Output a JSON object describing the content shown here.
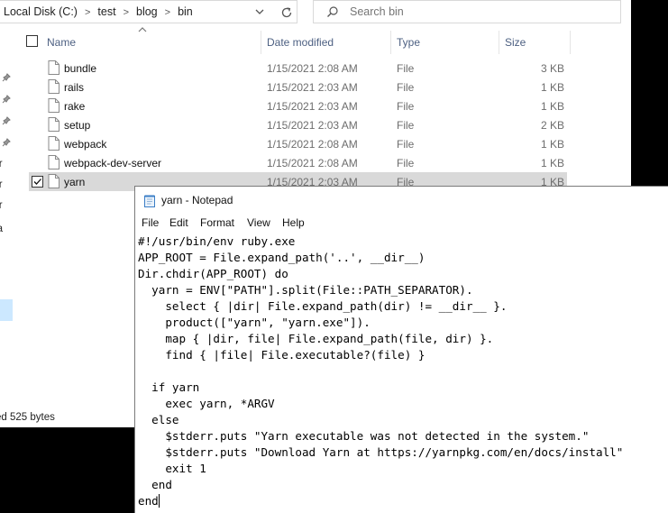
{
  "explorer": {
    "breadcrumb": [
      "Local Disk (C:)",
      "test",
      "blog",
      "bin"
    ],
    "search_placeholder": "Search bin",
    "columns": {
      "name": "Name",
      "date": "Date modified",
      "type": "Type",
      "size": "Size"
    },
    "files": [
      {
        "name": "bundle",
        "date": "1/15/2021 2:08 AM",
        "type": "File",
        "size": "3 KB"
      },
      {
        "name": "rails",
        "date": "1/15/2021 2:03 AM",
        "type": "File",
        "size": "1 KB"
      },
      {
        "name": "rake",
        "date": "1/15/2021 2:03 AM",
        "type": "File",
        "size": "1 KB"
      },
      {
        "name": "setup",
        "date": "1/15/2021 2:03 AM",
        "type": "File",
        "size": "2 KB"
      },
      {
        "name": "webpack",
        "date": "1/15/2021 2:08 AM",
        "type": "File",
        "size": "1 KB"
      },
      {
        "name": "webpack-dev-server",
        "date": "1/15/2021 2:08 AM",
        "type": "File",
        "size": "1 KB"
      },
      {
        "name": "yarn",
        "date": "1/15/2021 2:03 AM",
        "type": "File",
        "size": "1 KB"
      }
    ],
    "nav_fragments": [
      "eor",
      "eor",
      "eor",
      "Ea"
    ],
    "status": "ed  525 bytes"
  },
  "notepad": {
    "title": "yarn - Notepad",
    "menu": [
      "File",
      "Edit",
      "Format",
      "View",
      "Help"
    ],
    "content": "#!/usr/bin/env ruby.exe\nAPP_ROOT = File.expand_path('..', __dir__)\nDir.chdir(APP_ROOT) do\n  yarn = ENV[\"PATH\"].split(File::PATH_SEPARATOR).\n    select { |dir| File.expand_path(dir) != __dir__ }.\n    product([\"yarn\", \"yarn.exe\"]).\n    map { |dir, file| File.expand_path(file, dir) }.\n    find { |file| File.executable?(file) }\n\n  if yarn\n    exec yarn, *ARGV\n  else\n    $stderr.puts \"Yarn executable was not detected in the system.\"\n    $stderr.puts \"Download Yarn at https://yarnpkg.com/en/docs/install\"\n    exit 1\n  end\nend"
  },
  "colors": {
    "selected_row": "#d9d9d9",
    "header_text": "#4d6082",
    "nav_selected": "#cce8ff"
  }
}
